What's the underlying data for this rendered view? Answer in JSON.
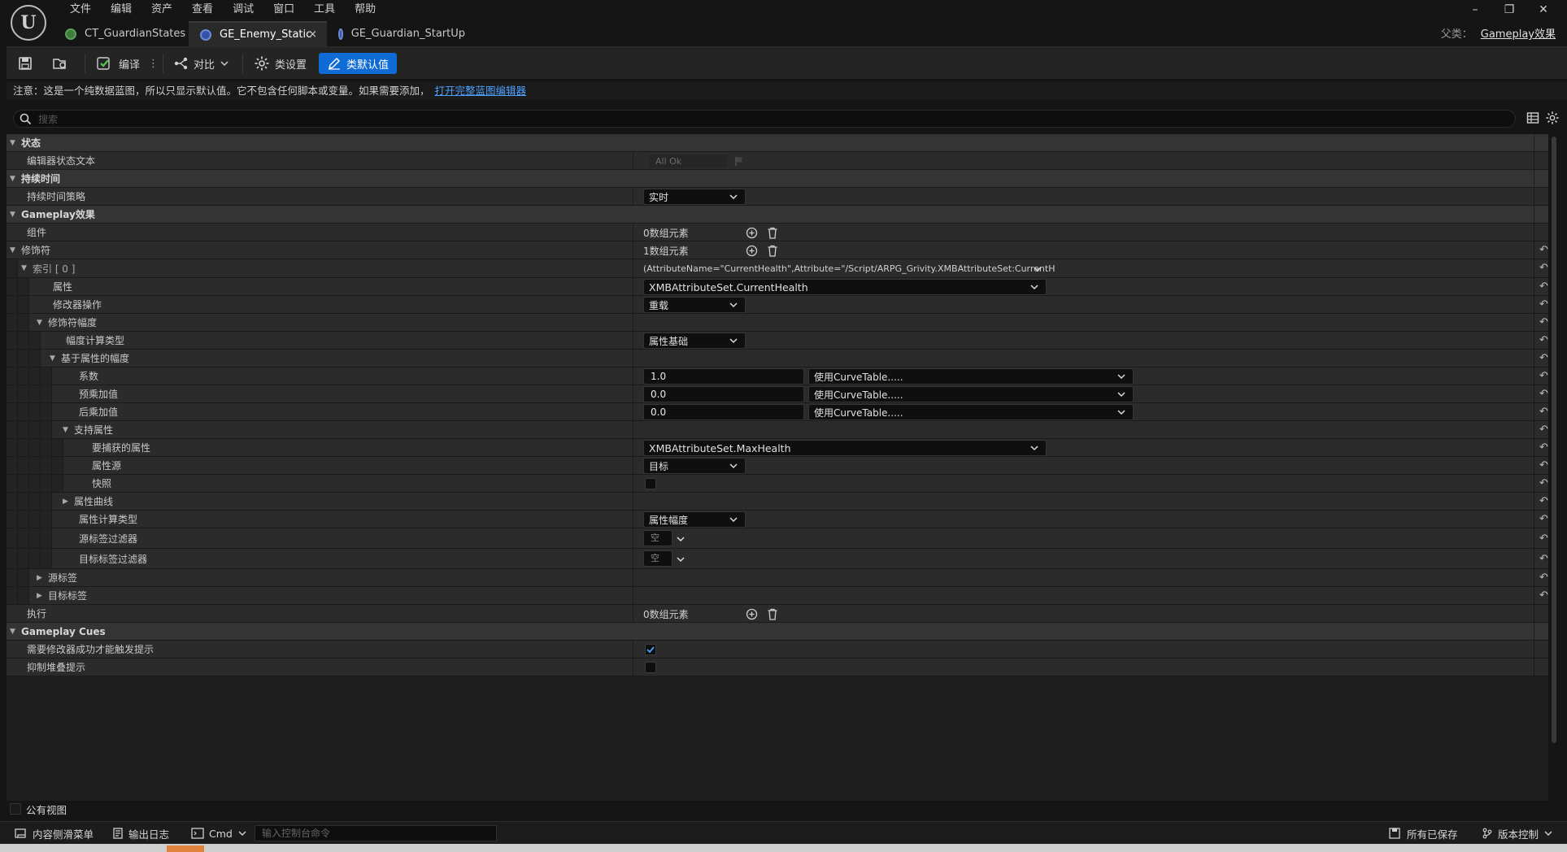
{
  "app": {
    "logo_text": "U",
    "menu": [
      "文件",
      "编辑",
      "资产",
      "查看",
      "调试",
      "窗口",
      "工具",
      "帮助"
    ],
    "tabs": [
      {
        "label": "CT_GuardianStates",
        "icon": "curve-table-icon",
        "color": "#3f7d3f"
      },
      {
        "label": "GE_Enemy_Static",
        "icon": "blueprint-icon",
        "color": "#3552a6",
        "active": true,
        "close": "×"
      },
      {
        "label": "GE_Guardian_StartUp",
        "icon": "blueprint-icon",
        "color": "#3552a6"
      }
    ],
    "parent_class_label": "父类：",
    "parent_class_value": "Gameplay效果",
    "window_controls": [
      "minimize-icon",
      "restore-icon",
      "close-icon"
    ]
  },
  "toolbar": {
    "compile_label": "编译",
    "diff_label": "对比",
    "class_settings_label": "类设置",
    "class_defaults_label": "类默认值"
  },
  "notice": {
    "text": "注意：这是一个纯数据蓝图，所以只显示默认值。它不包含任何脚本或变量。如果需要添加，",
    "link": "打开完整蓝图编辑器"
  },
  "search": {
    "placeholder": "搜索"
  },
  "details": {
    "status_category": "状态",
    "editor_status_text_label": "编辑器状态文本",
    "editor_status_text_value": "All Ok",
    "duration_category": "持续时间",
    "duration_policy_label": "持续时间策略",
    "duration_policy_value": "实时",
    "ge_category": "Gameplay效果",
    "components_label": "组件",
    "components_value": "0数组元素",
    "modifiers_label": "修饰符",
    "modifiers_value": "1数组元素",
    "index0_label": "索引 [ 0 ]",
    "index0_value": "(AttributeName=\"CurrentHealth\",Attribute=\"/Script/ARPG_Grivity.XMBAttributeSet:CurrentH",
    "attribute_label": "属性",
    "attribute_value": "XMBAttributeSet.CurrentHealth",
    "modifier_op_label": "修改器操作",
    "modifier_op_value": "重载",
    "modifier_magnitude_label": "修饰符幅度",
    "magnitude_calc_type_label": "幅度计算类型",
    "magnitude_calc_type_value": "属性基础",
    "attr_based_magnitude_label": "基于属性的幅度",
    "coefficient_label": "系数",
    "coefficient_value": "1.0",
    "pre_mult_label": "预乘加值",
    "pre_mult_value": "0.0",
    "post_mult_label": "后乘加值",
    "post_mult_value": "0.0",
    "curve_table_value": "使用CurveTable.....",
    "backing_attr_label": "支持属性",
    "captured_attr_label": "要捕获的属性",
    "captured_attr_value": "XMBAttributeSet.MaxHealth",
    "attr_source_label": "属性源",
    "attr_source_value": "目标",
    "snapshot_label": "快照",
    "attr_curve_label": "属性曲线",
    "attr_calc_type_label": "属性计算类型",
    "attr_calc_type_value": "属性幅度",
    "source_tag_filter_label": "源标签过滤器",
    "target_tag_filter_label": "目标标签过滤器",
    "empty_value": "空",
    "source_tags_label": "源标签",
    "target_tags_label": "目标标签",
    "executions_label": "执行",
    "executions_value": "0数组元素",
    "cues_category": "Gameplay Cues",
    "require_success_label": "需要修改器成功才能触发提示",
    "require_success_checked": true,
    "suppress_stacking_label": "抑制堆叠提示",
    "suppress_stacking_checked": false
  },
  "public_view_label": "公有视图",
  "statusbar": {
    "content_drawer": "内容侧滑菜单",
    "output_log": "输出日志",
    "cmd": "Cmd",
    "console_placeholder": "输入控制台命令",
    "all_saved": "所有已保存",
    "source_control": "版本控制"
  },
  "colors": {
    "accent": "#0f6cd6",
    "link": "#4ea1ff",
    "check": "#4ea1ff"
  }
}
